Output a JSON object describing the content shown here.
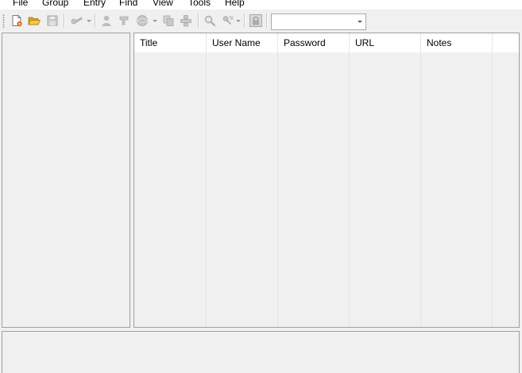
{
  "menu": {
    "items": [
      {
        "label": "File",
        "name": "menu-file"
      },
      {
        "label": "Group",
        "name": "menu-group"
      },
      {
        "label": "Entry",
        "name": "menu-entry"
      },
      {
        "label": "Find",
        "name": "menu-find"
      },
      {
        "label": "View",
        "name": "menu-view"
      },
      {
        "label": "Tools",
        "name": "menu-tools"
      },
      {
        "label": "Help",
        "name": "menu-help"
      }
    ]
  },
  "toolbar": {
    "buttons": [
      {
        "icon": "new-database-icon",
        "enabled": true
      },
      {
        "icon": "open-folder-icon",
        "enabled": true
      },
      {
        "icon": "save-icon",
        "enabled": false
      },
      {
        "icon": "add-entry-icon",
        "enabled": false
      },
      {
        "icon": "copy-username-icon",
        "enabled": false
      },
      {
        "icon": "copy-password-icon",
        "enabled": false
      },
      {
        "icon": "open-url-icon",
        "enabled": false
      },
      {
        "icon": "copy-entry-icon",
        "enabled": false
      },
      {
        "icon": "autotype-icon",
        "enabled": false
      },
      {
        "icon": "find-icon",
        "enabled": false
      },
      {
        "icon": "show-entries-icon",
        "enabled": false
      },
      {
        "icon": "lock-workspace-icon",
        "enabled": false
      }
    ],
    "quick_find": {
      "value": "",
      "placeholder": ""
    }
  },
  "entry_list": {
    "columns": [
      "Title",
      "User Name",
      "Password",
      "URL",
      "Notes"
    ],
    "rows": []
  },
  "colors": {
    "background": "#f0f0f0",
    "menubar": "#ffffff",
    "border": "#a0a0a0",
    "icon_disabled": "#a8a8a8",
    "folder": "#e8b730",
    "new_accent": "#e07020"
  }
}
